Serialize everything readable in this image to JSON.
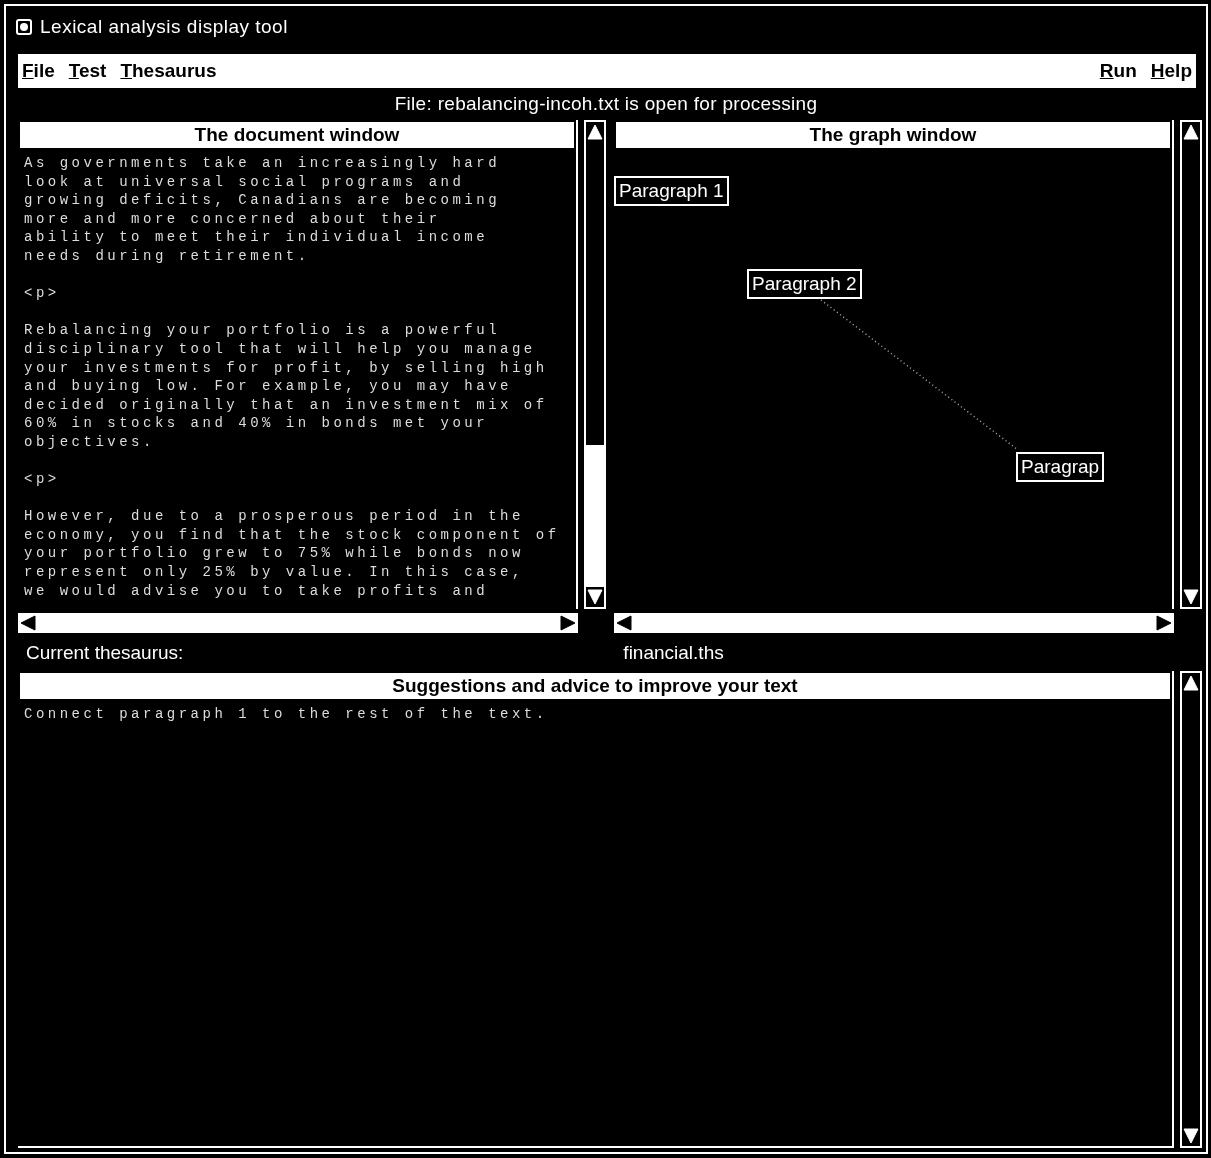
{
  "window": {
    "title": "Lexical analysis display tool"
  },
  "menu": {
    "left": [
      {
        "label": "File"
      },
      {
        "label": "Test"
      },
      {
        "label": "Thesaurus"
      }
    ],
    "right": [
      {
        "label": "Run"
      },
      {
        "label": "Help"
      }
    ]
  },
  "status": "File:  rebalancing-incoh.txt is open for processing",
  "document_window": {
    "title": "The document window",
    "blocks": [
      [
        "As governments take an increasingly hard",
        "look at universal social programs and",
        "growing deficits, Canadians are becoming",
        "more and more concerned about their",
        "ability to meet their individual income",
        "needs during retirement."
      ],
      [
        "<p>"
      ],
      [
        "Rebalancing your portfolio is a powerful",
        "disciplinary tool that will help you manage",
        "your investments for profit, by selling high",
        "and buying low. For example, you may have",
        "decided originally that an investment mix of",
        "60% in stocks and 40% in bonds met your",
        "objectives."
      ],
      [
        "<p>"
      ],
      [
        "However, due to a prosperous period in the",
        "economy, you find that the stock component of",
        "your portfolio grew to 75% while bonds now",
        "represent only 25% by value. In this case,",
        "we would advise you to take profits and"
      ]
    ]
  },
  "graph_window": {
    "title": "The graph window",
    "nodes": [
      {
        "label": "Paragraph 1",
        "linked_to_next": false
      },
      {
        "label": "Paragraph 2",
        "linked_to_next": true
      },
      {
        "label": "Paragrap",
        "linked_to_next": false
      }
    ]
  },
  "thesaurus": {
    "label": "Current thesaurus:",
    "value": "financial.ths"
  },
  "suggestions": {
    "title": "Suggestions and advice to improve your text",
    "lines": [
      "Connect paragraph 1 to the rest of the text."
    ]
  }
}
